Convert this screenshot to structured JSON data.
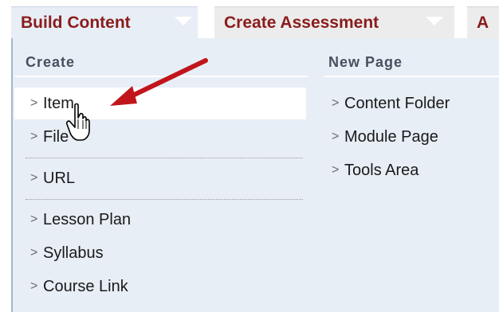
{
  "menubar": {
    "tabs": [
      {
        "label": "Build Content"
      },
      {
        "label": "Create Assessment"
      },
      {
        "label": "A"
      }
    ]
  },
  "dropdown": {
    "create_header": "Create",
    "newpage_header": "New Page",
    "create_items": [
      {
        "label": "Item"
      },
      {
        "label": "File"
      },
      {
        "label": "URL"
      },
      {
        "label": "Lesson Plan"
      },
      {
        "label": "Syllabus"
      },
      {
        "label": "Course Link"
      }
    ],
    "newpage_items": [
      {
        "label": "Content Folder"
      },
      {
        "label": "Module Page"
      },
      {
        "label": "Tools Area"
      }
    ],
    "chevron": ">"
  },
  "colors": {
    "tab_text": "#8a1c1c",
    "panel_bg": "#e8eef6",
    "annotation_arrow": "#c0161b"
  },
  "icons": {
    "pointer": "hand-pointer-icon",
    "annotation": "red-arrow-annotation-icon"
  }
}
